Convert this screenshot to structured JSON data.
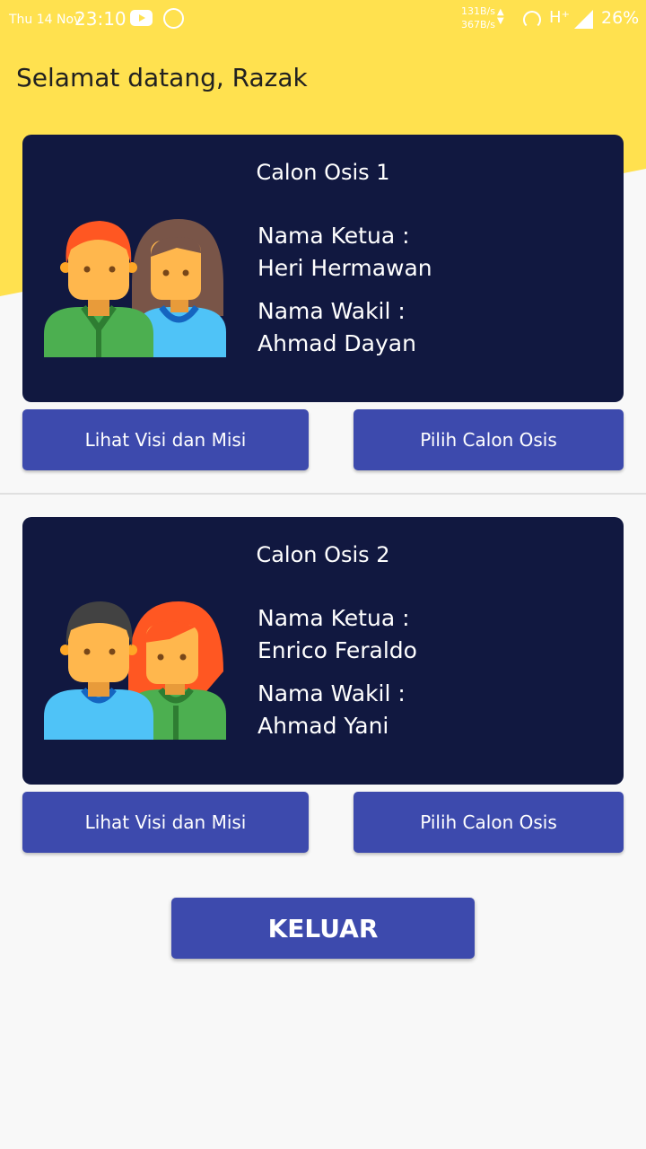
{
  "status_bar": {
    "date": "Thu 14 Nov",
    "time": "23:10",
    "speed_up": "131B/s",
    "speed_down": "367B/s",
    "network": "H⁺",
    "battery": "26%",
    "icons": [
      "youtube-icon",
      "whatsapp-icon",
      "hotspot-icon",
      "signal-icon"
    ]
  },
  "header": {
    "greeting": "Selamat datang, Razak"
  },
  "candidates": [
    {
      "title": "Calon Osis 1",
      "ketua_label": "Nama Ketua :",
      "ketua_name": "Heri Hermawan",
      "wakil_label": "Nama Wakil :",
      "wakil_name": "Ahmad Dayan",
      "btn_visi": "Lihat Visi dan Misi",
      "btn_pilih": "Pilih Calon Osis"
    },
    {
      "title": "Calon Osis 2",
      "ketua_label": "Nama Ketua :",
      "ketua_name": "Enrico Feraldo",
      "wakil_label": "Nama Wakil :",
      "wakil_name": "Ahmad Yani",
      "btn_visi": "Lihat Visi dan Misi",
      "btn_pilih": "Pilih Calon Osis"
    }
  ],
  "footer": {
    "exit_label": "KELUAR"
  },
  "colors": {
    "header_bg": "#ffe14f",
    "card_bg": "#111840",
    "button_bg": "#3d4aad"
  }
}
